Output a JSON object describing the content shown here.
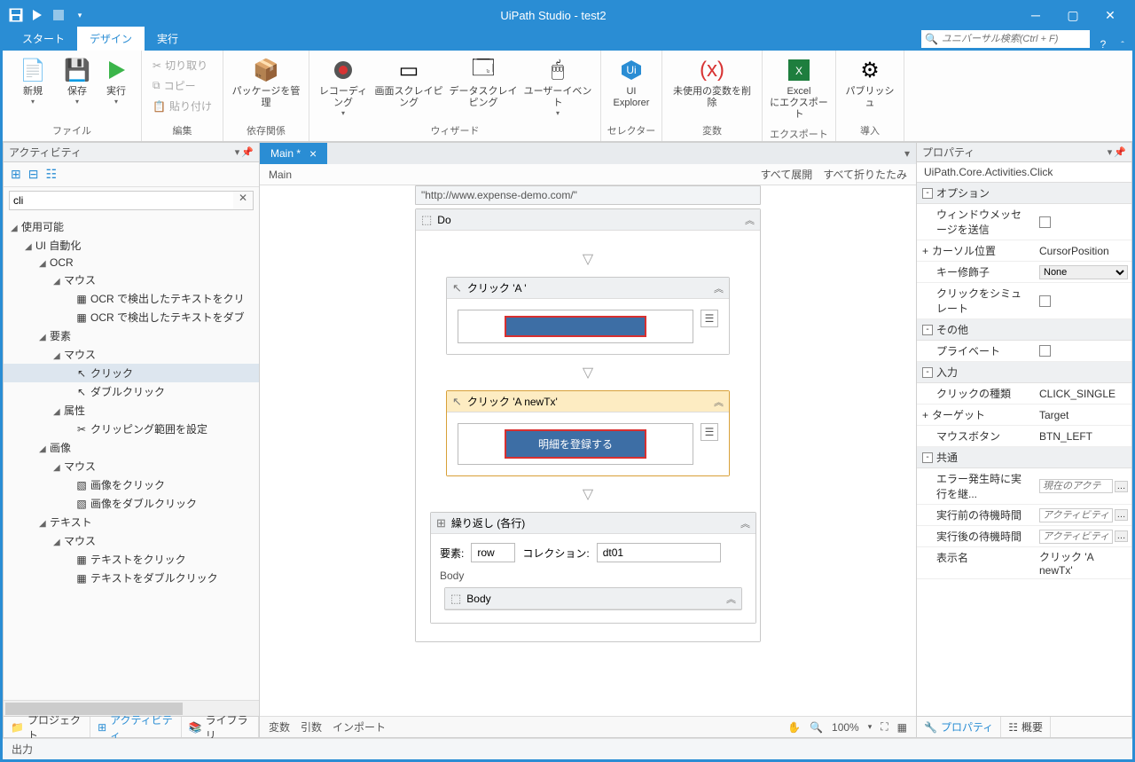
{
  "title": "UiPath Studio - test2",
  "titlebar": {
    "save": "save",
    "run": "run",
    "stop": "stop"
  },
  "tabs": {
    "start": "スタート",
    "design": "デザイン",
    "run": "実行"
  },
  "search_placeholder": "ユニバーサル検索(Ctrl + F)",
  "ribbon": {
    "file": {
      "label": "ファイル",
      "new": "新規",
      "save": "保存",
      "run": "実行"
    },
    "edit": {
      "label": "編集",
      "cut": "切り取り",
      "copy": "コピー",
      "paste": "貼り付け"
    },
    "deps": {
      "label": "依存関係",
      "manage": "パッケージを管理"
    },
    "wizard": {
      "label": "ウィザード",
      "rec": "レコーディング",
      "screen": "画面スクレイピング",
      "data": "データスクレイピング",
      "events": "ユーザーイベント"
    },
    "selector": {
      "label": "セレクター",
      "uiex": "UI\nExplorer"
    },
    "vars": {
      "label": "変数",
      "remove": "未使用の変数を削除"
    },
    "export": {
      "label": "エクスポート",
      "excel": "Excel\nにエクスポート"
    },
    "deploy": {
      "label": "導入",
      "publish": "パブリッシュ"
    }
  },
  "activities": {
    "title": "アクティビティ",
    "search": "cli",
    "tree": {
      "root": "使用可能",
      "uia": "UI 自動化",
      "ocr": "OCR",
      "mouse": "マウス",
      "ocr1": "OCR で検出したテキストをクリ",
      "ocr2": "OCR で検出したテキストをダブ",
      "element": "要素",
      "click": "クリック",
      "dblclick": "ダブルクリック",
      "attr": "属性",
      "clip": "クリッピング範囲を設定",
      "image": "画像",
      "imgclick": "画像をクリック",
      "imgdbl": "画像をダブルクリック",
      "text": "テキスト",
      "txtclick": "テキストをクリック",
      "txtdbl": "テキストをダブルクリック"
    },
    "foot": {
      "project": "プロジェクト",
      "activities": "アクティビティ",
      "library": "ライブラリ"
    }
  },
  "designer": {
    "tab": "Main *",
    "crumb": "Main",
    "expand_all": "すべて展開",
    "collapse_all": "すべて折りたたみ",
    "url": "\"http://www.expense-demo.com/\"",
    "do": "Do",
    "click1": "クリック 'A  '",
    "click2": "クリック 'A  newTx'",
    "btn_label": "明細を登録する",
    "foreach": "繰り返し (各行)",
    "fe_item": "要素:",
    "fe_item_v": "row",
    "fe_coll": "コレクション:",
    "fe_coll_v": "dt01",
    "body": "Body",
    "body2": "Body",
    "foot": {
      "vars": "変数",
      "args": "引数",
      "imports": "インポート",
      "zoom": "100%"
    }
  },
  "props": {
    "title": "プロパティ",
    "class": "UiPath.Core.Activities.Click",
    "cat_options": "オプション",
    "sendwm": "ウィンドウメッセージを送信",
    "cursor": "カーソル位置",
    "cursor_v": "CursorPosition",
    "keymod": "キー修飾子",
    "keymod_v": "None",
    "sim": "クリックをシミュレート",
    "cat_other": "その他",
    "private": "プライベート",
    "cat_input": "入力",
    "clicktype": "クリックの種類",
    "clicktype_v": "CLICK_SINGLE",
    "target": "ターゲット",
    "target_v": "Target",
    "mbtn": "マウスボタン",
    "mbtn_v": "BTN_LEFT",
    "cat_common": "共通",
    "continue": "エラー発生時に実行を継...",
    "continue_ph": "現在のアクテ",
    "before": "実行前の待機時間",
    "before_ph": "アクティビティ",
    "after": "実行後の待機時間",
    "after_ph": "アクティビティ",
    "display": "表示名",
    "display_v": "クリック 'A  newTx'",
    "foot": {
      "properties": "プロパティ",
      "outline": "概要"
    }
  },
  "status": "出力"
}
